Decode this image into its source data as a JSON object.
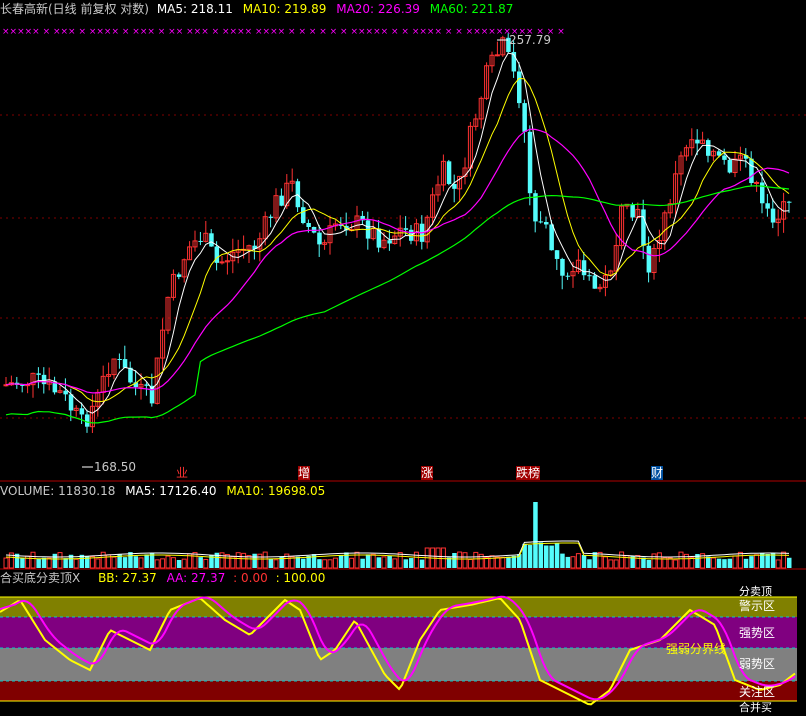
{
  "header": {
    "title": "长春高新(日线 前复权 对数)",
    "ma5": "MA5: 218.11",
    "ma10": "MA10: 219.89",
    "ma20": "MA20: 226.39",
    "ma60": "MA60: 221.87"
  },
  "markers": {
    "high_price": "257.79",
    "low_price": "168.50",
    "x_markers": "××××× ×  ×××  ×   ×××× ×   ×××  ×  ×× ××× ×  ×××× ×××× × × × ×  × × ××××× ×  ×  ×××× ×  ×  ××××××××× ×  × ×"
  },
  "events": [
    {
      "label": "业"
    },
    {
      "label": "增"
    },
    {
      "label": "涨"
    },
    {
      "label": "跌榜"
    },
    {
      "label": "财"
    }
  ],
  "volume_header": {
    "volume": "VOLUME: 11830.18",
    "ma5": "MA5: 17126.40",
    "ma10": "MA10: 19698.05"
  },
  "indicator_header": {
    "name": "合买底分卖顶X",
    "bb": "BB: 27.37",
    "aa": "AA: 27.37",
    "v0": ": 0.00",
    "v100": ": 100.00"
  },
  "zones": {
    "top": "分卖顶",
    "warning": "警示区",
    "strong": "强势区",
    "boundary": "强弱分界线",
    "weak": "弱势区",
    "attention": "关注区",
    "bottom": "合并买"
  },
  "colors": {
    "up": "#ff3232",
    "down": "#54fcfc",
    "ma5": "#ffffff",
    "ma10": "#ffff00",
    "ma20": "#ff00ff",
    "ma60": "#00ff00",
    "zone_yellow": "#808000",
    "zone_purple": "#800080",
    "zone_gray": "#808080",
    "zone_red": "#800000"
  }
}
